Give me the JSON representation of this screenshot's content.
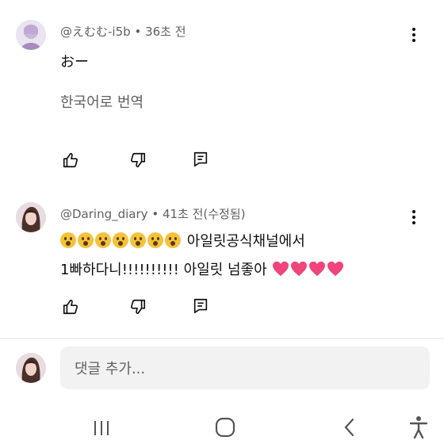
{
  "comments": [
    {
      "author": "@えむむ-i5b",
      "separator": "•",
      "time": "36초 전",
      "text": "おー",
      "translate": "한국어로 번역"
    },
    {
      "author": "@Daring_diary",
      "separator": "•",
      "time": "41초 전(수정됨)",
      "line1_text": "아일릿공식채널에서",
      "line2_text": "1빠하다니!!!!!!!!!! 아일릿 넘좋아",
      "emoji_count": 7,
      "heart_count": 4
    }
  ],
  "add_comment": {
    "placeholder": "댓글 추가..."
  },
  "icons": {
    "like": "thumbs-up-icon",
    "dislike": "thumbs-down-icon",
    "reply": "comment-reply-icon",
    "more": "more-vert-icon",
    "emoji": "astonished-face-emoji",
    "heart": "pink-heart-emoji"
  },
  "colors": {
    "heart": "#f0457a",
    "emoji": "#f5c33b",
    "meta_text": "#606060"
  }
}
